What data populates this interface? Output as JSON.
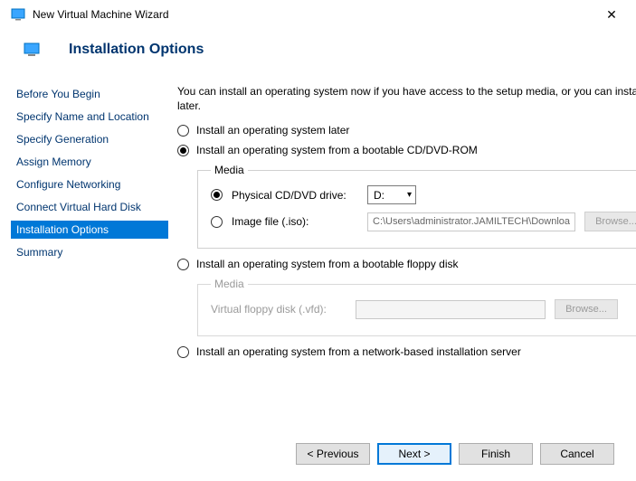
{
  "window": {
    "title": "New Virtual Machine Wizard"
  },
  "page": {
    "heading": "Installation Options"
  },
  "sidebar": {
    "items": [
      {
        "label": "Before You Begin"
      },
      {
        "label": "Specify Name and Location"
      },
      {
        "label": "Specify Generation"
      },
      {
        "label": "Assign Memory"
      },
      {
        "label": "Configure Networking"
      },
      {
        "label": "Connect Virtual Hard Disk"
      },
      {
        "label": "Installation Options"
      },
      {
        "label": "Summary"
      }
    ],
    "active_index": 6
  },
  "content": {
    "intro": "You can install an operating system now if you have access to the setup media, or you can install it later.",
    "options": {
      "later": "Install an operating system later",
      "cd": "Install an operating system from a bootable CD/DVD-ROM",
      "floppy": "Install an operating system from a bootable floppy disk",
      "network": "Install an operating system from a network-based installation server"
    },
    "media_cd": {
      "legend": "Media",
      "physical_label": "Physical CD/DVD drive:",
      "drive_value": "D:",
      "image_label": "Image file (.iso):",
      "image_value": "C:\\Users\\administrator.JAMILTECH\\Downloads\\",
      "browse": "Browse..."
    },
    "media_floppy": {
      "legend": "Media",
      "vfd_label": "Virtual floppy disk (.vfd):",
      "vfd_value": "",
      "browse": "Browse..."
    }
  },
  "footer": {
    "previous": "< Previous",
    "next": "Next >",
    "finish": "Finish",
    "cancel": "Cancel"
  }
}
